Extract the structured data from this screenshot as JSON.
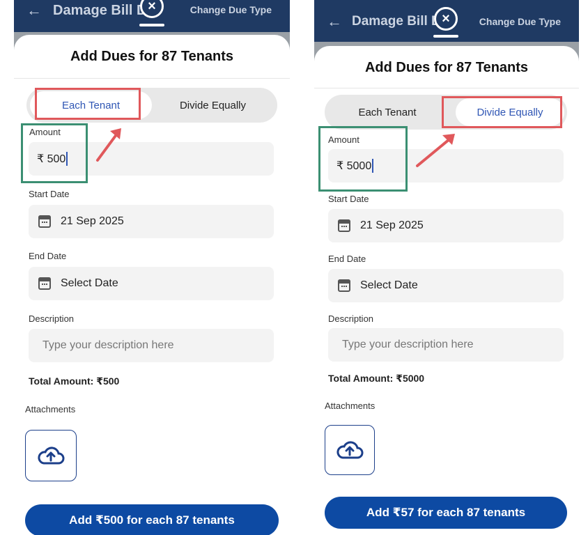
{
  "left": {
    "header": {
      "title": "Damage Bill D",
      "change_due_type": "Change Due Type"
    },
    "sheet_title": "Add Dues for 87 Tenants",
    "toggle": {
      "option_1": "Each Tenant",
      "option_2": "Divide Equally",
      "selected": "Each Tenant"
    },
    "amount": {
      "label": "Amount",
      "value": "₹ 500"
    },
    "start_date": {
      "label": "Start Date",
      "value": "21 Sep 2025"
    },
    "end_date": {
      "label": "End Date",
      "placeholder": "Select Date"
    },
    "description": {
      "label": "Description",
      "placeholder": "Type your description here"
    },
    "total": "Total Amount: ₹500",
    "attachments_label": "Attachments",
    "cta": "Add ₹500 for each 87 tenants"
  },
  "right": {
    "header": {
      "title": "Damage Bill D",
      "change_due_type": "Change Due Type"
    },
    "sheet_title": "Add Dues for 87 Tenants",
    "toggle": {
      "option_1": "Each Tenant",
      "option_2": "Divide Equally",
      "selected": "Divide Equally"
    },
    "amount": {
      "label": "Amount",
      "value": "₹ 5000"
    },
    "start_date": {
      "label": "Start Date",
      "value": "21 Sep 2025"
    },
    "end_date": {
      "label": "End Date",
      "placeholder": "Select Date"
    },
    "description": {
      "label": "Description",
      "placeholder": "Type your description here"
    },
    "total": "Total Amount: ₹5000",
    "attachments_label": "Attachments",
    "cta": "Add ₹57 for each 87 tenants"
  },
  "icons": {
    "back": "arrow-left-icon",
    "close": "close-circle-icon",
    "calendar": "calendar-icon",
    "upload": "cloud-upload-icon"
  },
  "colors": {
    "header_bg": "#1f3a63",
    "accent": "#2f56b4",
    "cta": "#0d4aa3",
    "highlight_red": "#e0585b",
    "highlight_green": "#3b8f72"
  }
}
